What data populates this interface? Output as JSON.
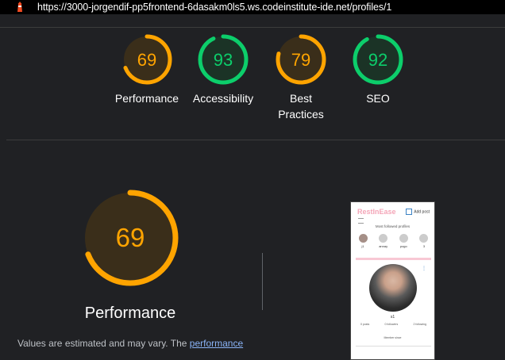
{
  "browser": {
    "url": "https://3000-jorgendif-pp5frontend-6dasakm0ls5.ws.codeinstitute-ide.net/profiles/1"
  },
  "colors": {
    "average": "#ffa400",
    "average_bg": "#3a2e1a",
    "pass": "#0cce6b",
    "pass_bg": "#1b3326",
    "track": "#3c3c3c"
  },
  "scores": [
    {
      "score": "69",
      "label": "Performance",
      "rating": "average"
    },
    {
      "score": "93",
      "label": "Accessibility",
      "rating": "pass"
    },
    {
      "score": "79",
      "label": "Best Practices",
      "rating": "average"
    },
    {
      "score": "92",
      "label": "SEO",
      "rating": "pass"
    }
  ],
  "main": {
    "score": "69",
    "label": "Performance",
    "note_prefix": "Values are estimated and may vary. The ",
    "note_link": "performance"
  },
  "screenshot": {
    "brand": "RestInEase",
    "add_post": "Add post",
    "most_followed": "Most followed profiles",
    "profiles": [
      "j1",
      "annay",
      "pogo",
      "3"
    ],
    "username": "s1",
    "stats": [
      "0 posts",
      "0 followers",
      "2 following"
    ],
    "since": "Member since"
  }
}
